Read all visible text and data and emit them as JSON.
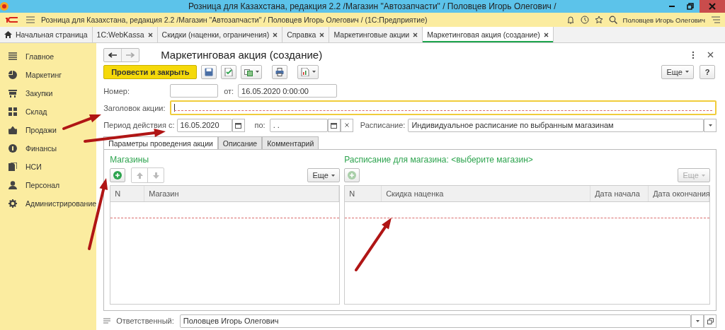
{
  "window": {
    "title": "Розница для Казахстана, редакция 2.2 /Магазин \"Автозапчасти\" / Половцев Игорь Олегович /"
  },
  "app_bar": {
    "title": "Розница для Казахстана, редакция 2.2 /Магазин \"Автозапчасти\" / Половцев Игорь Олегович /  (1С:Предприятие)",
    "user": "Половцев Игорь Олегович"
  },
  "open_tabs": [
    {
      "kind": "home",
      "label": "Начальная страница",
      "selected": false
    },
    {
      "kind": "doc",
      "label": "1С:WebKassa",
      "selected": false
    },
    {
      "kind": "doc",
      "label": "Скидки (наценки, ограничения)",
      "selected": false
    },
    {
      "kind": "doc",
      "label": "Справка",
      "selected": false
    },
    {
      "kind": "doc",
      "label": "Маркетинговые акции",
      "selected": false
    },
    {
      "kind": "doc",
      "label": "Маркетинговая акция (создание)",
      "selected": true
    }
  ],
  "sidebar": {
    "items": [
      {
        "label": "Главное"
      },
      {
        "label": "Маркетинг"
      },
      {
        "label": "Закупки"
      },
      {
        "label": "Склад"
      },
      {
        "label": "Продажи"
      },
      {
        "label": "Финансы"
      },
      {
        "label": "НСИ"
      },
      {
        "label": "Персонал"
      },
      {
        "label": "Администрирование"
      }
    ]
  },
  "form": {
    "title": "Маркетинговая акция (создание)",
    "toolbar": {
      "primary": "Провести и закрыть",
      "more": "Еще",
      "help": "?"
    },
    "fields": {
      "number_label": "Номер:",
      "date_label": "от:",
      "date_value": "16.05.2020  0:00:00",
      "heading_label": "Заголовок акции:",
      "heading_required": true,
      "period_label": "Период действия с:",
      "period_from": "16.05.2020",
      "period_to_label": "по:",
      "period_to": " .  . ",
      "schedule_label": "Расписание:",
      "schedule_value": "Индивидуальное расписание по выбранным магазинам"
    },
    "tabs": [
      {
        "label": "Параметры проведения акции",
        "selected": true
      },
      {
        "label": "Описание",
        "selected": false
      },
      {
        "label": "Комментарий",
        "selected": false
      }
    ],
    "stores": {
      "title": "Магазины",
      "more": "Еще",
      "columns": [
        "N",
        "Магазин"
      ],
      "required": true
    },
    "schedule": {
      "title": "Расписание для магазина: <выберите магазин>",
      "more": "Еще",
      "disabled": true,
      "columns": [
        "N",
        "Скидка наценка",
        "Дата начала",
        "Дата окончания"
      ],
      "required": true
    },
    "responsible": {
      "label": "Ответственный:",
      "value": "Половцев Игорь Олегович"
    }
  },
  "annotation_arrows": [
    {
      "kind": "arrow"
    },
    {
      "kind": "arrow"
    },
    {
      "kind": "arrow"
    },
    {
      "kind": "arrow"
    }
  ]
}
